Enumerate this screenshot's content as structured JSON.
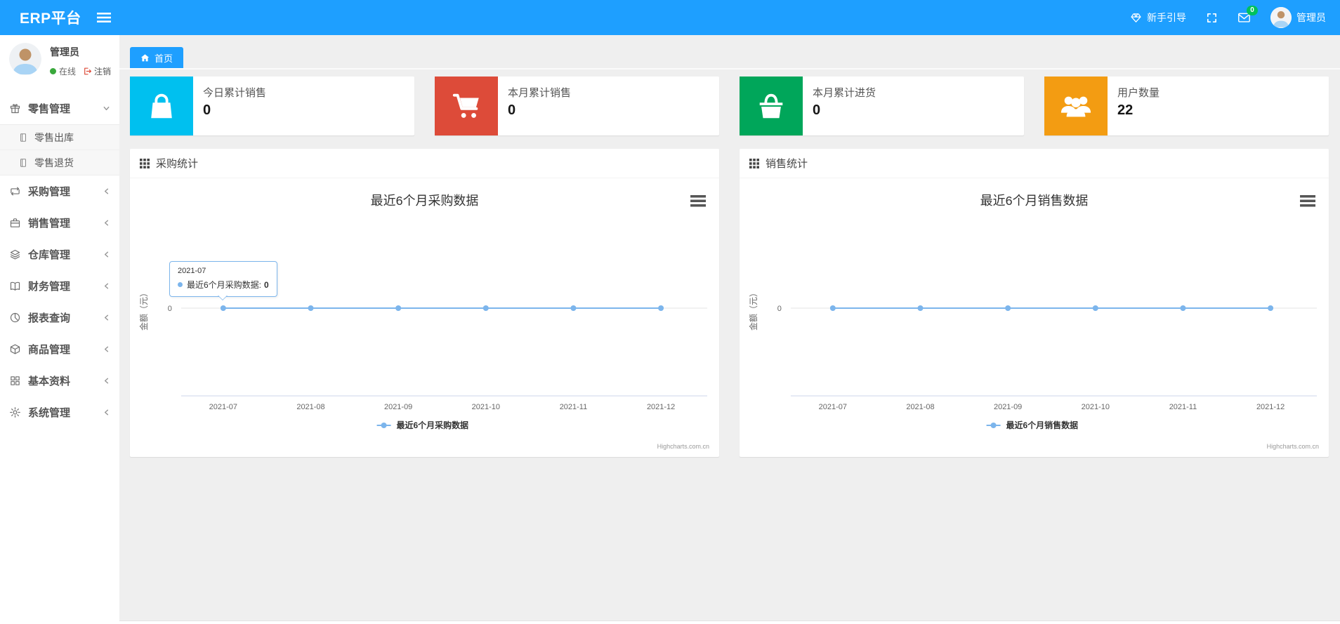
{
  "theme": {
    "primary": "#1E9FFF",
    "content_bg": "#efefef",
    "panel_bg": "#ffffff"
  },
  "navbar": {
    "brand": "ERP平台",
    "guide_label": "新手引导",
    "messages_badge": "0",
    "badge_color": "#00c15c",
    "username": "管理员"
  },
  "sidebar": {
    "user": {
      "name": "管理员",
      "status": "在线",
      "status_color": "#39a83b",
      "logout": "注销",
      "logout_color": "#dd4b39"
    },
    "menu": [
      {
        "label": "零售管理",
        "icon": "gift-icon",
        "state": "expanded",
        "children": [
          {
            "label": "零售出库",
            "icon": "doc-icon"
          },
          {
            "label": "零售退货",
            "icon": "doc-icon"
          }
        ]
      },
      {
        "label": "采购管理",
        "icon": "repeat-icon",
        "state": "collapsed"
      },
      {
        "label": "销售管理",
        "icon": "briefcase-icon",
        "state": "collapsed"
      },
      {
        "label": "仓库管理",
        "icon": "layers-icon",
        "state": "collapsed"
      },
      {
        "label": "财务管理",
        "icon": "book-icon",
        "state": "collapsed"
      },
      {
        "label": "报表查询",
        "icon": "pie-chart-icon",
        "state": "collapsed"
      },
      {
        "label": "商品管理",
        "icon": "box-icon",
        "state": "collapsed"
      },
      {
        "label": "基本资料",
        "icon": "grid-icon",
        "state": "collapsed"
      },
      {
        "label": "系统管理",
        "icon": "gear-icon",
        "state": "collapsed"
      }
    ]
  },
  "tabs": {
    "home": "首页"
  },
  "stats": [
    {
      "label": "今日累计销售",
      "value": "0",
      "color": "#00c0ef",
      "icon": "shopping-bag-icon"
    },
    {
      "label": "本月累计销售",
      "value": "0",
      "color": "#dd4b39",
      "icon": "cart-icon"
    },
    {
      "label": "本月累计进货",
      "value": "0",
      "color": "#00a65a",
      "icon": "basket-icon"
    },
    {
      "label": "用户数量",
      "value": "22",
      "color": "#f39c12",
      "icon": "users-icon"
    }
  ],
  "panels": [
    {
      "title": "采购统计",
      "icon": "th-grid-icon"
    },
    {
      "title": "销售统计",
      "icon": "th-grid-icon"
    }
  ],
  "chart_data": [
    {
      "type": "line",
      "title": "最近6个月采购数据",
      "categories": [
        "2021-07",
        "2021-08",
        "2021-09",
        "2021-10",
        "2021-11",
        "2021-12"
      ],
      "series": [
        {
          "name": "最近6个月采购数据",
          "values": [
            0,
            0,
            0,
            0,
            0,
            0
          ],
          "color": "#7cb5ec"
        }
      ],
      "xlabel": "",
      "ylabel": "金额（元）",
      "yticks": [
        "0"
      ],
      "ylim": [
        -1,
        1
      ],
      "grid": false,
      "legend_position": "bottom",
      "credit": "Highcharts.com.cn",
      "tooltip": {
        "visible": true,
        "category": "2021-07",
        "label": "最近6个月采购数据:",
        "value": "0"
      }
    },
    {
      "type": "line",
      "title": "最近6个月销售数据",
      "categories": [
        "2021-07",
        "2021-08",
        "2021-09",
        "2021-10",
        "2021-11",
        "2021-12"
      ],
      "series": [
        {
          "name": "最近6个月销售数据",
          "values": [
            0,
            0,
            0,
            0,
            0,
            0
          ],
          "color": "#7cb5ec"
        }
      ],
      "xlabel": "",
      "ylabel": "金额（元）",
      "yticks": [
        "0"
      ],
      "ylim": [
        -1,
        1
      ],
      "grid": false,
      "legend_position": "bottom",
      "credit": "Highcharts.com.cn",
      "tooltip": {
        "visible": false
      }
    }
  ]
}
